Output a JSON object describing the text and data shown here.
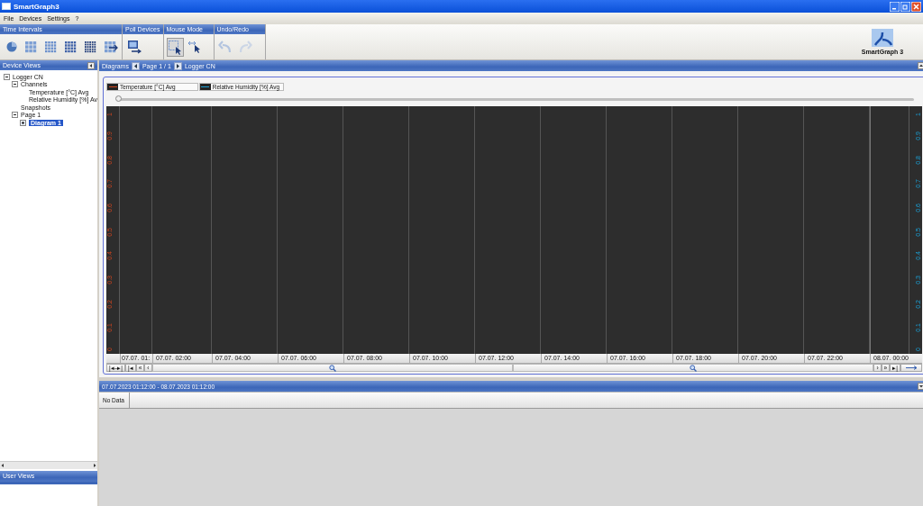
{
  "window": {
    "title": "SmartGraph3"
  },
  "menu": [
    "File",
    "Devices",
    "Settings",
    "?"
  ],
  "toolbar_groups": [
    {
      "title": "Time Intervals",
      "buttons": [
        {
          "kind": "pie"
        },
        {
          "kind": "grid-small"
        },
        {
          "kind": "grid-medium"
        },
        {
          "kind": "grid-large"
        },
        {
          "kind": "grid-dense"
        },
        {
          "kind": "grid-arrow"
        }
      ]
    },
    {
      "title": "Poll Devices",
      "buttons": [
        {
          "kind": "monitor"
        }
      ]
    },
    {
      "title": "Mouse Mode",
      "buttons": [
        {
          "kind": "select",
          "selected": true
        },
        {
          "kind": "pan",
          "selected": false
        }
      ]
    },
    {
      "title": "Undo/Redo",
      "buttons": [
        {
          "kind": "undo",
          "disabled": true
        },
        {
          "kind": "redo",
          "disabled": true
        }
      ]
    }
  ],
  "logo": {
    "label": "SmartGraph 3"
  },
  "device_views": {
    "title": "Device Views",
    "tree": [
      {
        "label": "Logger CN",
        "expanded": true,
        "selected": false,
        "children": [
          {
            "label": "Channels",
            "expanded": true,
            "selected": false,
            "children": [
              {
                "label": "Temperature [°C] Avg",
                "selected": false
              },
              {
                "label": "Relative Humidity [%] Av",
                "selected": false
              }
            ]
          },
          {
            "label": "Snapshots",
            "selected": false
          },
          {
            "label": "Page 1",
            "expanded": true,
            "selected": false,
            "children": [
              {
                "label": "Diagram 1",
                "expanded": false,
                "selected": true
              }
            ]
          }
        ]
      }
    ]
  },
  "user_views": {
    "title": "User Views"
  },
  "diagrams_bar": {
    "title": "Diagrams",
    "page": "Page 1 / 1",
    "device": "Logger CN"
  },
  "legend": [
    {
      "name": "Temperature [°C] Avg",
      "color": "#d2451e"
    },
    {
      "name": "Relative Humidity [%] Avg",
      "color": "#1a9fd4"
    }
  ],
  "time_slider": {
    "level": 0
  },
  "left_axis_ticks": [
    "1",
    "0.9",
    "0.8",
    "0.7",
    "0.6",
    "0.5",
    "0.4",
    "0.3",
    "0.2",
    "0.1",
    "0"
  ],
  "right_axis_ticks": [
    "1",
    "0.9",
    "0.8",
    "0.7",
    "0.6",
    "0.5",
    "0.4",
    "0.3",
    "0.2",
    "0.1",
    "0"
  ],
  "time_labels": [
    "07.07. 01:",
    "07.07. 02:00",
    "07.07. 04:00",
    "07.07. 06:00",
    "07.07. 08:00",
    "07.07. 10:00",
    "07.07. 12:00",
    "07.07. 14:00",
    "07.07. 16:00",
    "07.07. 18:00",
    "07.07. 20:00",
    "07.07. 22:00",
    "08.07. 00:00"
  ],
  "nav_left": [
    "|◂–▸|",
    "|◂",
    "«",
    "‹"
  ],
  "nav_right": [
    "›",
    "»",
    "▸|"
  ],
  "range_bar": {
    "title": "07.07.2023 01:12:00 - 08.07.2023 01:12:00"
  },
  "table": {
    "columns": [
      "No Data"
    ]
  }
}
